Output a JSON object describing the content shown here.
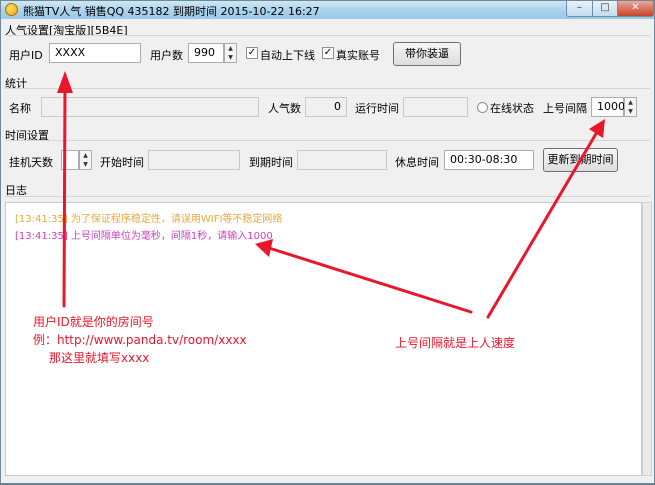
{
  "window": {
    "title": "熊猫TV人气 销售QQ 435182 到期时间 2015-10-22 16:27",
    "min": "–",
    "max": "□",
    "close": "✕"
  },
  "popularity": {
    "section": "人气设置[淘宝版][5B4E]",
    "user_id_label": "用户ID",
    "user_id_value": "XXXX",
    "user_count_label": "用户数",
    "user_count_value": "990",
    "auto_online_label": "自动上下线",
    "auto_online_checked": true,
    "real_account_label": "真实账号",
    "real_account_checked": true,
    "install_button": "带你装逼"
  },
  "stats": {
    "section": "统计",
    "name_label": "名称",
    "name_value": "",
    "pop_label": "人气数",
    "pop_value": "0",
    "run_time_label": "运行时间",
    "run_time_value": "",
    "online_status_label": "在线状态",
    "interval_label": "上号间隔",
    "interval_value": "1000"
  },
  "time": {
    "section": "时间设置",
    "days_label": "挂机天数",
    "days_value": "",
    "start_label": "开始时间",
    "start_value": "",
    "expire_label": "到期时间",
    "expire_value": "",
    "rest_label": "休息时间",
    "rest_value": "00:30-08:30",
    "update_button": "更新到期时间"
  },
  "log": {
    "section": "日志",
    "lines": [
      {
        "text": "[13:41:35] 为了保证程序稳定性，请误用WIFI等不稳定网络",
        "color": "#e8a83a"
      },
      {
        "text": "[13:41:35] 上号间隔单位为毫秒，间隔1秒，请输入1000",
        "color": "#d040c0"
      }
    ]
  },
  "annotations": {
    "user_id_note_1": "用户ID就是你的房间号",
    "user_id_note_2": "例：http://www.panda.tv/room/xxxx",
    "user_id_note_3": "那这里就填写xxxx",
    "interval_note": "上号间隔就是上人速度",
    "color": "#e8172b"
  }
}
